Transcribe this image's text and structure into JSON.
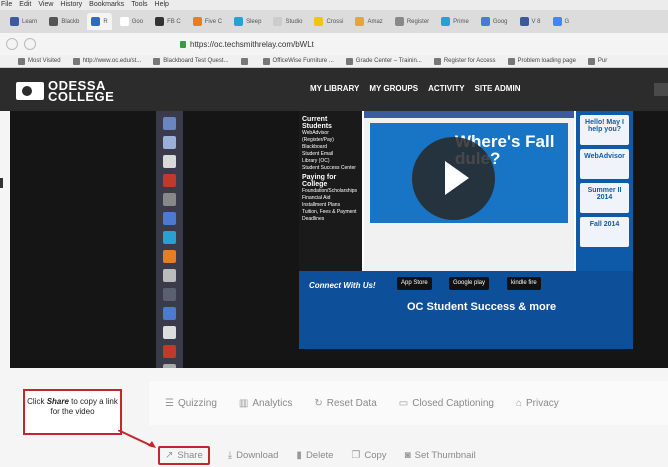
{
  "menu": [
    "File",
    "Edit",
    "View",
    "History",
    "Bookmarks",
    "Tools",
    "Help"
  ],
  "tabs": [
    {
      "label": "Learn",
      "color": "#3b5aa0"
    },
    {
      "label": "Blackb",
      "color": "#555555"
    },
    {
      "label": "R",
      "color": "#2a6ebd"
    },
    {
      "label": "Goo",
      "color": "#ffffff"
    },
    {
      "label": "FB C",
      "color": "#333333"
    },
    {
      "label": "Five C",
      "color": "#e67e22"
    },
    {
      "label": "Sleep",
      "color": "#2a9fd6"
    },
    {
      "label": "Studio",
      "color": "#cccccc"
    },
    {
      "label": "Crossi",
      "color": "#f1c40f"
    },
    {
      "label": "Amaz",
      "color": "#e8a33a"
    },
    {
      "label": "Register",
      "color": "#888888"
    },
    {
      "label": "Prime",
      "color": "#2a9fd6"
    },
    {
      "label": "Goog",
      "color": "#4a7bd0"
    },
    {
      "label": "V 8",
      "color": "#3b5998"
    },
    {
      "label": "G",
      "color": "#4285f4"
    }
  ],
  "url": "https://oc.techsmithrelay.com/bWLt",
  "bookmarks": [
    "Most Visited",
    "http://www.oc.edu/st...",
    "Blackboard Test Quest...",
    "",
    "OfficeWise Furniture ...",
    "Grade Center – Trainin...",
    "Register for Access",
    "Problem loading page",
    "Pur"
  ],
  "site": {
    "logo_line1": "ODESSA",
    "logo_line2": "COLLEGE",
    "nav": [
      "MY LIBRARY",
      "MY GROUPS",
      "ACTIVITY",
      "SITE ADMIN"
    ]
  },
  "video": {
    "left_heading1": "Current Students",
    "left_items1": [
      "WebAdvisor (Register/Pay)",
      "Blackboard",
      "Student Email",
      "Library (OC)",
      "Student Success Center"
    ],
    "left_heading2": "Paying for College",
    "left_items2": [
      "Foundation/Scholarships",
      "Financial Aid",
      "Installment Plans",
      "Tuition, Fees & Payment Deadlines"
    ],
    "promo": "Where's Fall dule?",
    "right_box1": "Hello! May I help you?",
    "right_box2": "WebAdvisor",
    "right_box3": "Summer II 2014",
    "right_box4": "Fall 2014",
    "connect": "Connect With Us!",
    "badge1": "App Store",
    "badge2": "Google play",
    "badge3": "kindle fire",
    "success": "OC Student Success & more"
  },
  "toolbar1": [
    "Quizzing",
    "Analytics",
    "Reset Data",
    "Closed Captioning",
    "Privacy"
  ],
  "toolbar2": [
    "Share",
    "Download",
    "Delete",
    "Copy",
    "Set Thumbnail"
  ],
  "callout": {
    "pre": "Click ",
    "emph": "Share",
    "post": " to copy a link for the video"
  }
}
